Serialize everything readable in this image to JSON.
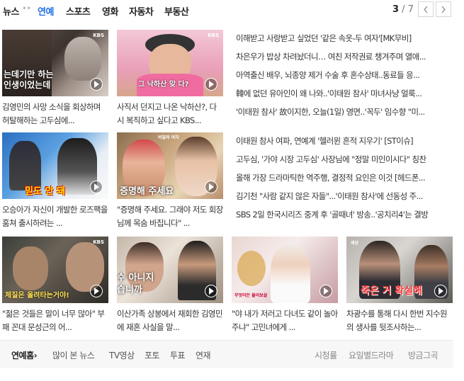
{
  "nav": {
    "items": [
      "뉴스",
      "연예",
      "스포츠",
      "영화",
      "자동차",
      "부동산"
    ],
    "active_index": 1,
    "dots": "••",
    "pager": {
      "current": "3",
      "total": "7",
      "separator": " / "
    }
  },
  "cards_top": [
    {
      "caption": "김영민의 사망 소식을 회상하며 허탈해하는 고두심에...",
      "overlay": "는데기만 하는\n인생이었는데",
      "badge": "KBS"
    },
    {
      "caption": "사직서 던지고 나온 낙하산?, 다시 복직하고 싶다고 KBS...",
      "overlay": "그 낙하산 맞 다?",
      "badge": "KBS"
    }
  ],
  "cards_mid": [
    {
      "caption": "오승아가 자신이 개발한 로즈팩을 훔쳐 출시하려는 ...",
      "overlay": "믿도 안 돼"
    },
    {
      "caption": "\"증명해 주세요. 그래야 저도 회장님께 목숨 바칩니다\" ...",
      "overlay": "증명해 주세요",
      "badge": "비밀의 여자"
    }
  ],
  "cards_bottom": [
    {
      "caption": "\"젊은 것들은 말이 너무 많아\" 부패 꼰대 문성근의 어...",
      "overlay": "체질은 올려타는거야!",
      "badge": "KBS"
    },
    {
      "caption": "이산가족 상봉에서 재회한 김영민에 재혼 사실을 말...",
      "overlay": "수 아니지\n습니까"
    },
    {
      "caption": "\"야 내가 저러고 다녀도 같이 놀아주냐\" 고민녀에게 ...",
      "overlay": "무엇이든 물어보살"
    },
    {
      "caption": "차광수를 통해 다시 한번 지수원의 생사를 뒷조사하는...",
      "overlay": "죽은 거 확실해",
      "badge": "세상"
    }
  ],
  "headlines_1": [
    "이해받고 사랑받고 싶었던 '같은 속옷-두 여자'[MK무비]",
    "차은우가 밥상 차려놨더니… 여친 저작권료 챙겨주며 열애...",
    "아역출신 배우, 뇌종양 제거 수술 후 혼수상태..동료들 응...",
    "韓에 없던 유아인이 왜 나와..'이태원 참사' 마녀사냥 얼룩...",
    "'이태원 참사' 故이지한, 오늘(1일) 영면..'꼭두' 임수향 \"미..."
  ],
  "headlines_2": [
    "이태원 참사 여파, 연예계 '헬러윈 흔적 지우기' [ST이슈]",
    "고두심, '가야 시장 고두심' 사장님에 \"정말 미인이시다\" 칭찬",
    "올해 가장 드라마틱한 역주행, 결정적 요인은 이것 [헤드폰...",
    "김기천 \"사람 같지 않은 자들\"...'이태원 참사'에 선동성 주...",
    "SBS 2일 한국시리즈 중계 후 '골때녀' 방송..'공치리4'는 결방"
  ],
  "bottom": {
    "home": "연예홈",
    "home_arrow": "›",
    "links": [
      "많이 본 뉴스",
      "TV영상",
      "포토",
      "투표",
      "연재"
    ],
    "right_links": [
      "시청률",
      "요일별드라마",
      "방금그곡"
    ]
  },
  "colors": {
    "active": "#1f6ee8",
    "text": "#333333"
  }
}
